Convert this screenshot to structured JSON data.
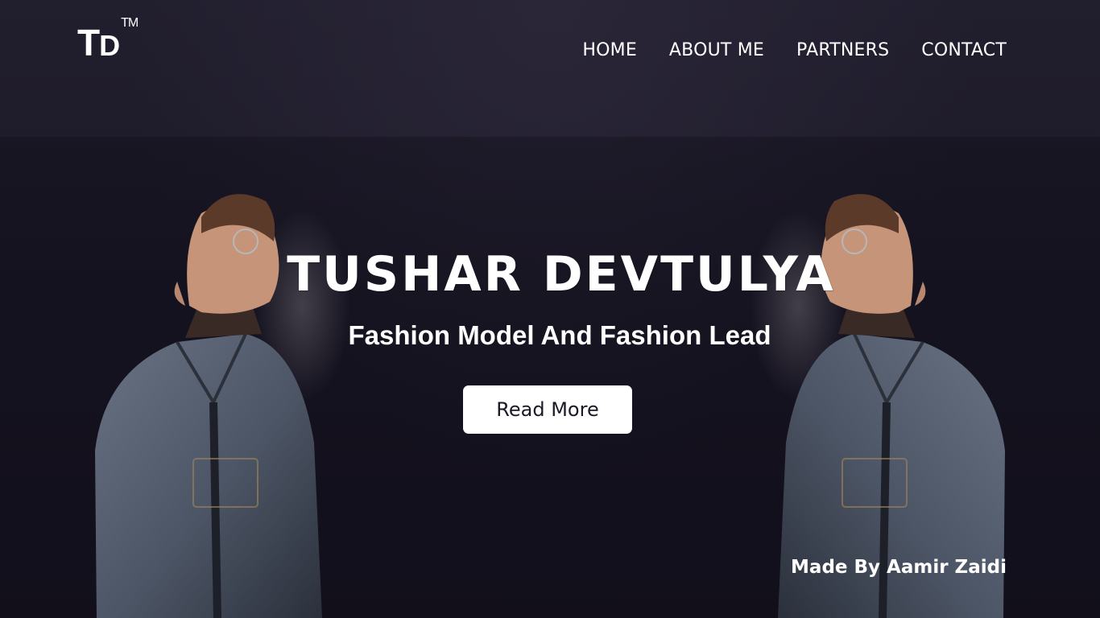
{
  "brand": {
    "logo_t": "T",
    "logo_d": "D",
    "logo_tm": "TM"
  },
  "nav": {
    "items": [
      "HOME",
      "ABOUT ME",
      "PARTNERS",
      "CONTACT"
    ]
  },
  "hero": {
    "title": "TUSHAR DEVTULYA",
    "subtitle": "Fashion Model And Fashion Lead",
    "cta_label": "Read More"
  },
  "footer": {
    "credit": "Made By Aamir Zaidi"
  },
  "colors": {
    "background": "#1e1b2b",
    "text": "#ffffff",
    "button_bg": "#ffffff",
    "button_text": "#1c1926",
    "jacket": "#4f5a6b"
  }
}
